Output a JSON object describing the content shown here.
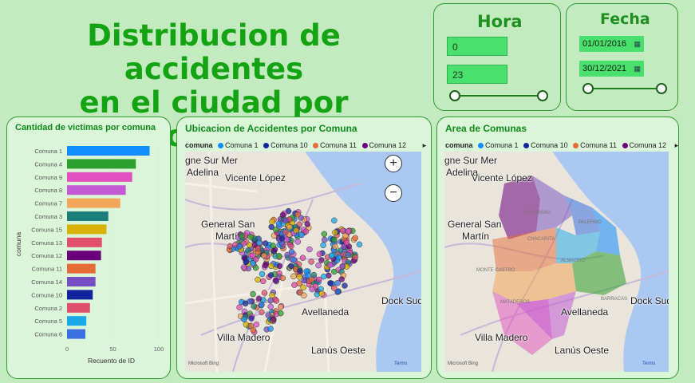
{
  "title": {
    "line1": "Distribucion de accidentes",
    "line2": "en el ciudad por comuna"
  },
  "hora": {
    "title": "Hora",
    "from": "0",
    "to": "23",
    "slider_from": 0,
    "slider_to": 1
  },
  "fecha": {
    "title": "Fecha",
    "from": "01/01/2016",
    "to": "30/12/2021",
    "calendar_icon": "calendar-icon",
    "slider_from": 0,
    "slider_to": 1
  },
  "bar_panel": {
    "title": "Cantidad de victimas por comuna"
  },
  "map_panel": {
    "title": "Ubicacion de Accidentes por Comuna",
    "legend_label": "comuna",
    "legend_items": [
      "Comuna 1",
      "Comuna 10",
      "Comuna 11",
      "Comuna 12"
    ],
    "zoom_in": "+",
    "zoom_out": "−",
    "attribution": "Microsoft Bing",
    "terms": "Terms"
  },
  "area_panel": {
    "title": "Area de Comunas",
    "legend_label": "comuna",
    "legend_items": [
      "Comuna 1",
      "Comuna 10",
      "Comuna 11",
      "Comuna 12"
    ],
    "attribution": "Microsoft Bing",
    "terms": "Terms"
  },
  "map_labels": {
    "gne_sur_mer": "gne Sur Mer",
    "adelina": "Adelina",
    "vicente_lopez": "Vicente López",
    "general_san": "General San",
    "martin": "Martín",
    "avellaneda": "Avellaneda",
    "villa_madero": "Villa Madero",
    "lanus_oeste": "Lanús Oeste",
    "dock_sud": "Dock Sud",
    "mataderos": "MATADEROS",
    "belgrano": "BELGRANO",
    "chacarita": "CHACARITA",
    "almagro": "ALMAGRO",
    "monte_castro": "MONTE CASTRO",
    "palermo": "PALERMO",
    "barracas": "BARRACAS"
  },
  "colors": {
    "Comuna 1": "#118dff",
    "Comuna 10": "#12239e",
    "Comuna 11": "#e66c37",
    "Comuna 12": "#6b007b",
    "Comuna 2": "#e044a7",
    "Comuna 3": "#1a7f7a",
    "Comuna 4": "#2ca02c",
    "Comuna 5": "#1aa8e8",
    "Comuna 6": "#3b6fe0",
    "Comuna 7": "#f2a65a",
    "Comuna 8": "#c55bd4",
    "Comuna 9": "#e24fc0",
    "Comuna 13": "#e0506a",
    "Comuna 14": "#744ec2",
    "Comuna 15": "#d9b300"
  },
  "chart_data": {
    "type": "bar",
    "orientation": "horizontal",
    "categories": [
      "Comuna 1",
      "Comuna 4",
      "Comuna 9",
      "Comuna 8",
      "Comuna 7",
      "Comuna 3",
      "Comuna 15",
      "Comuna 13",
      "Comuna 12",
      "Comuna 11",
      "Comuna 14",
      "Comuna 10",
      "Comuna 2",
      "Comuna 5",
      "Comuna 6"
    ],
    "values": [
      90,
      75,
      71,
      64,
      58,
      45,
      43,
      38,
      37,
      31,
      31,
      28,
      25,
      21,
      20
    ],
    "bar_colors": [
      "#118dff",
      "#2ca02c",
      "#e24fc0",
      "#c55bd4",
      "#f2a65a",
      "#1a7f7a",
      "#d9b300",
      "#e0506a",
      "#6b007b",
      "#e66c37",
      "#744ec2",
      "#12239e",
      "#e0506a",
      "#1aa8e8",
      "#3b6fe0"
    ],
    "xlabel": "Recuento de ID",
    "ylabel": "comuna",
    "xlim": [
      0,
      100
    ],
    "xticks": [
      "0",
      "50",
      "100"
    ]
  }
}
